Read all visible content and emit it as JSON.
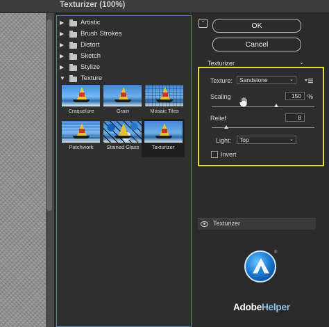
{
  "window": {
    "title": "Texturizer (100%)"
  },
  "categories": [
    {
      "label": "Artistic",
      "expanded": false
    },
    {
      "label": "Brush Strokes",
      "expanded": false
    },
    {
      "label": "Distort",
      "expanded": false
    },
    {
      "label": "Sketch",
      "expanded": false
    },
    {
      "label": "Stylize",
      "expanded": false
    },
    {
      "label": "Texture",
      "expanded": true
    }
  ],
  "thumbnails": [
    {
      "label": "Craquelure",
      "selected": false
    },
    {
      "label": "Grain",
      "selected": false
    },
    {
      "label": "Mosaic Tiles",
      "selected": false
    },
    {
      "label": "Patchwork",
      "selected": false
    },
    {
      "label": "Stained Glass",
      "selected": false
    },
    {
      "label": "Texturizer",
      "selected": true
    }
  ],
  "buttons": {
    "ok": "OK",
    "cancel": "Cancel"
  },
  "filter_select": {
    "value": "Texturizer"
  },
  "settings": {
    "texture_label": "Texture:",
    "texture_value": "Sandstone",
    "scaling_label": "Scaling",
    "scaling_value": "150",
    "scaling_unit": "%",
    "relief_label": "Relief",
    "relief_value": "8",
    "light_label": "Light:",
    "light_value": "Top",
    "invert_label": "Invert",
    "invert_checked": false
  },
  "layers": {
    "row_label": "Texturizer"
  },
  "watermark": {
    "brand_part1": "Adobe",
    "brand_part2": "Helper",
    "registered": "®"
  },
  "colors": {
    "highlight_border": "#e3e02a",
    "selection_border": "#5b87b8"
  }
}
